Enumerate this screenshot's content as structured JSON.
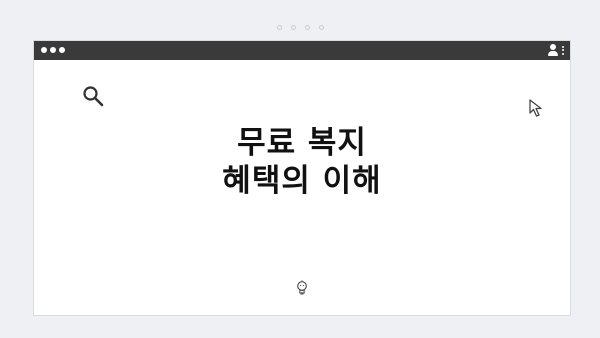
{
  "window": {
    "title_lines": [
      "무료 복지",
      "혜택의 이해"
    ]
  },
  "icons": {
    "search": "search-icon",
    "cursor": "cursor-icon",
    "bulb": "lightbulb-icon",
    "user": "user-icon",
    "menu": "kebab-menu-icon"
  }
}
